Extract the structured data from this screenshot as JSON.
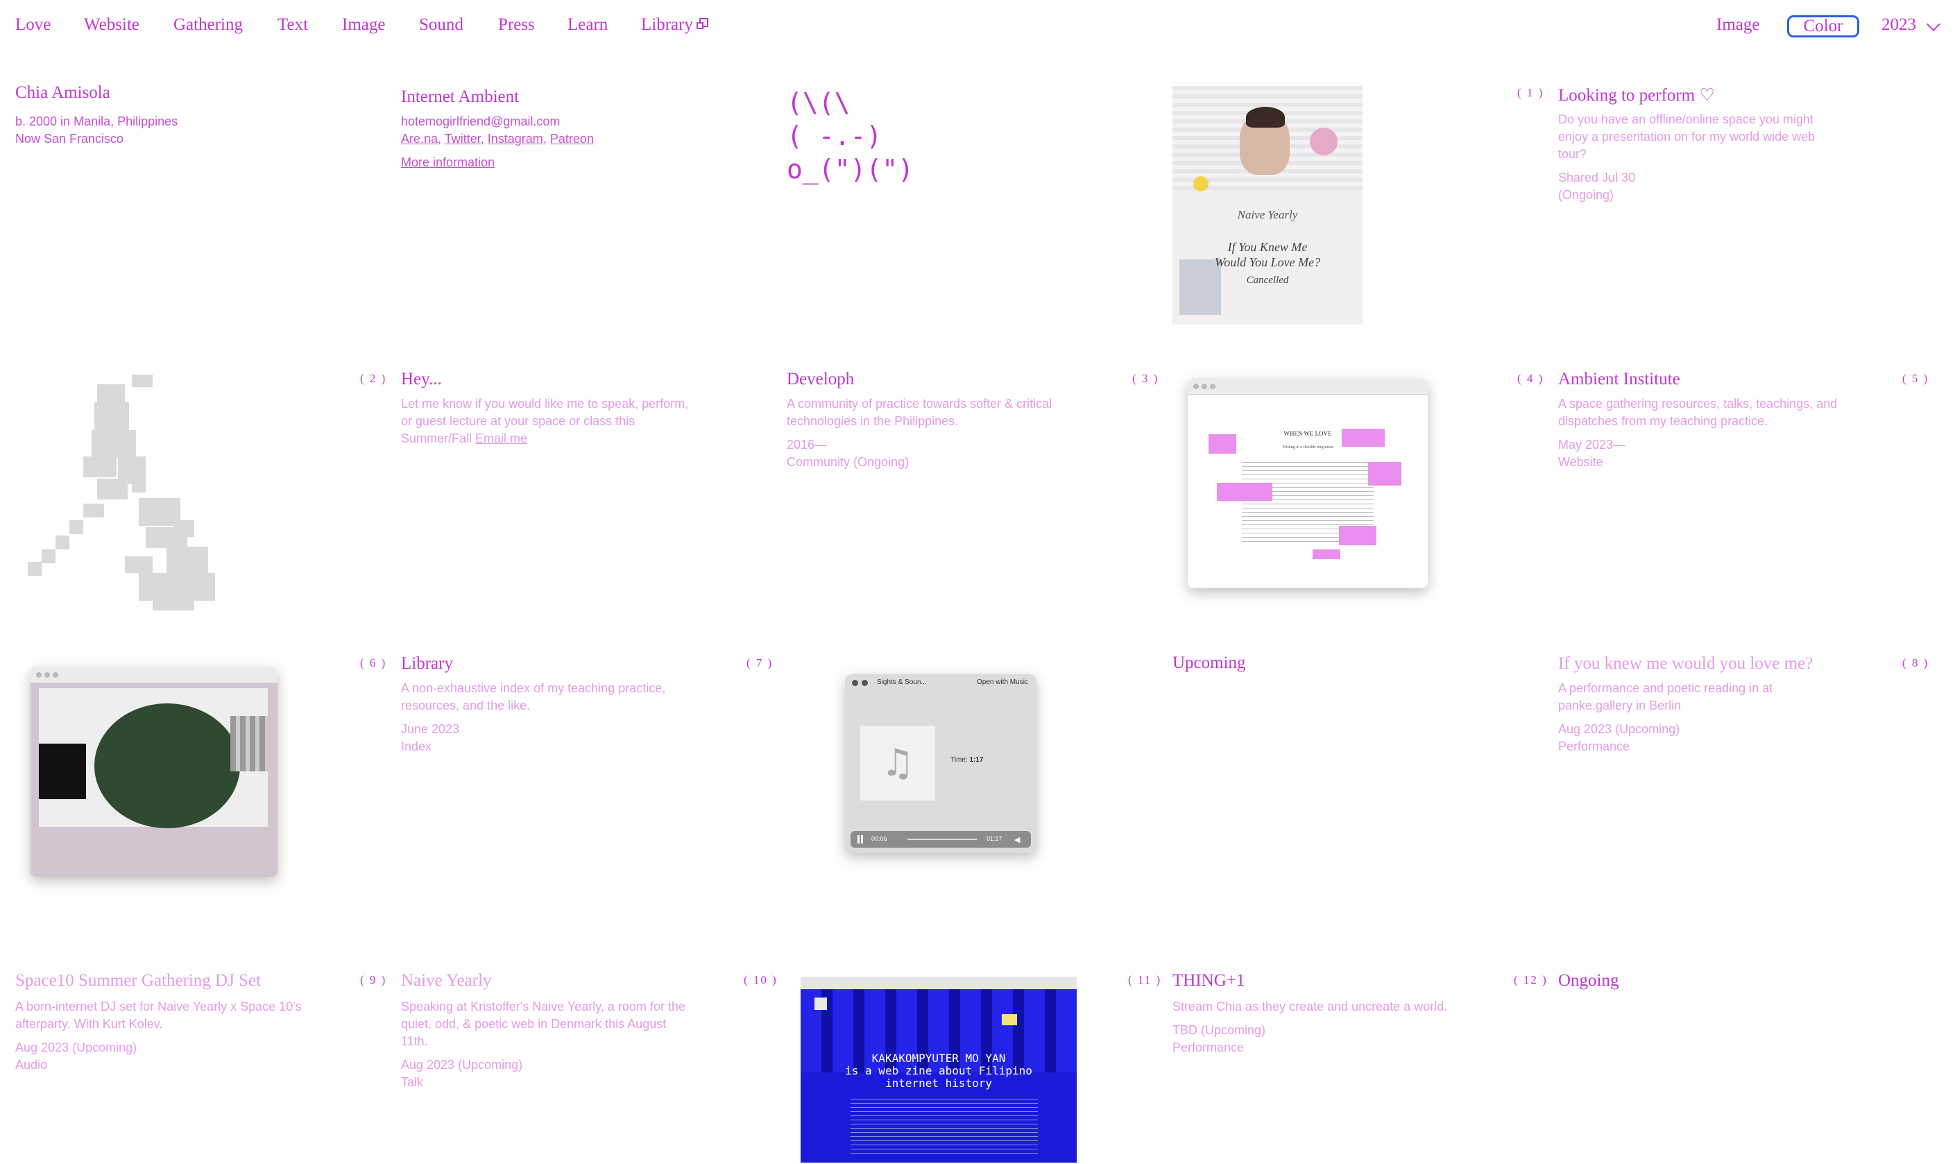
{
  "nav": {
    "left": [
      "Love",
      "Website",
      "Gathering",
      "Text",
      "Image",
      "Sound",
      "Press",
      "Learn",
      "Library"
    ],
    "right_image": "Image",
    "right_color": "Color",
    "right_year": "2023"
  },
  "profile": {
    "name": "Chia Amisola",
    "born": "b. 2000 in Manila, Philippines",
    "now": "Now San Francisco"
  },
  "contact": {
    "title": "Internet Ambient",
    "email": "hotemogirlfriend@gmail.com",
    "links": [
      "Are.na",
      "Twitter",
      "Instagram",
      "Patreon"
    ],
    "more": "More information"
  },
  "emoticon": {
    "line1": "(\\(\\",
    "line2": "( -.-)",
    "line3": "o_(\")(\")"
  },
  "items": [
    {
      "num": "( 1 )",
      "title": "Looking to perform ♡",
      "desc": "Do you have an offline/online space you might enjoy a presentation on for my world wide web tour?",
      "meta1": "Shared Jul 30",
      "meta2": "(Ongoing)"
    },
    {
      "num": "( 2 )",
      "title": "Hey...",
      "desc": "Let me know if you would like me to speak, perform, or guest lecture at your space or class this Summer/Fall",
      "link": "Email me"
    },
    {
      "num": "( 3 )",
      "title": "Developh",
      "desc": "A community of practice towards softer & critical technologies in the Philippines.",
      "meta1": "2016—",
      "meta2": "Community (Ongoing)"
    },
    {
      "num": "( 4 )",
      "title": "Ambient Institute",
      "desc": "A space gathering resources, talks, teachings, and dispatches from my teaching practice.",
      "meta1": "May 2023—",
      "meta2": "Website"
    },
    {
      "num": "( 5 )"
    },
    {
      "num": "( 6 )",
      "title": "Library",
      "desc": "A non-exhaustive index of my teaching practice, resources, and the like.",
      "meta1": "June 2023",
      "meta2": "Index"
    },
    {
      "num": "( 7 )",
      "title": "Upcoming"
    },
    {
      "num": "( 8 )",
      "title": "If you knew me would you love me?",
      "desc": "A performance and poetic reading in at panke.gallery in Berlin",
      "meta1": "Aug 2023 (Upcoming)",
      "meta2": "Performance"
    },
    {
      "num": "( 9 )",
      "title": "Space10 Summer Gathering DJ Set",
      "desc": "A born-internet DJ set for Naive Yearly x Space 10's afterparty. With Kurt Kolev.",
      "meta1": "Aug 2023 (Upcoming)",
      "meta2": "Audio"
    },
    {
      "num": "( 10 )",
      "title": "Naive Yearly",
      "desc": "Speaking at Kristoffer's Naive Yearly, a room for the quiet, odd, & poetic web in Denmark this August 11th.",
      "meta1": "Aug 2023 (Upcoming)",
      "meta2": "Talk"
    },
    {
      "num": "( 11 )",
      "title": "THING+1",
      "desc": "Stream Chia as they create and uncreate a world.",
      "meta1": "TBD (Upcoming)",
      "meta2": "Performance"
    },
    {
      "num": "( 12 )",
      "title": "Ongoing"
    }
  ],
  "poster": {
    "l1": "Naive Yearly",
    "l2": "If You Knew Me",
    "l3": "Would You Love Me?",
    "l4": "Cancelled"
  },
  "developh_shot": {
    "heading": "WHEN WE LOVE",
    "sub": "Writing in a flexible migration"
  },
  "player": {
    "title": "Sights & Soun...",
    "open": "Open with Music",
    "time_label": "Time:",
    "time": "1:17",
    "elapsed": "00:06",
    "remaining": "01:17"
  },
  "zine": {
    "line1": "KAKAKOMPYUTER MO YAN",
    "line2": "is a web zine about Filipino",
    "line3": "internet history"
  },
  "colors": {
    "accent": "#c038d0",
    "light": "#e59be8",
    "outline": "#2f5fd8",
    "zine_bg": "#1a1ad8"
  }
}
